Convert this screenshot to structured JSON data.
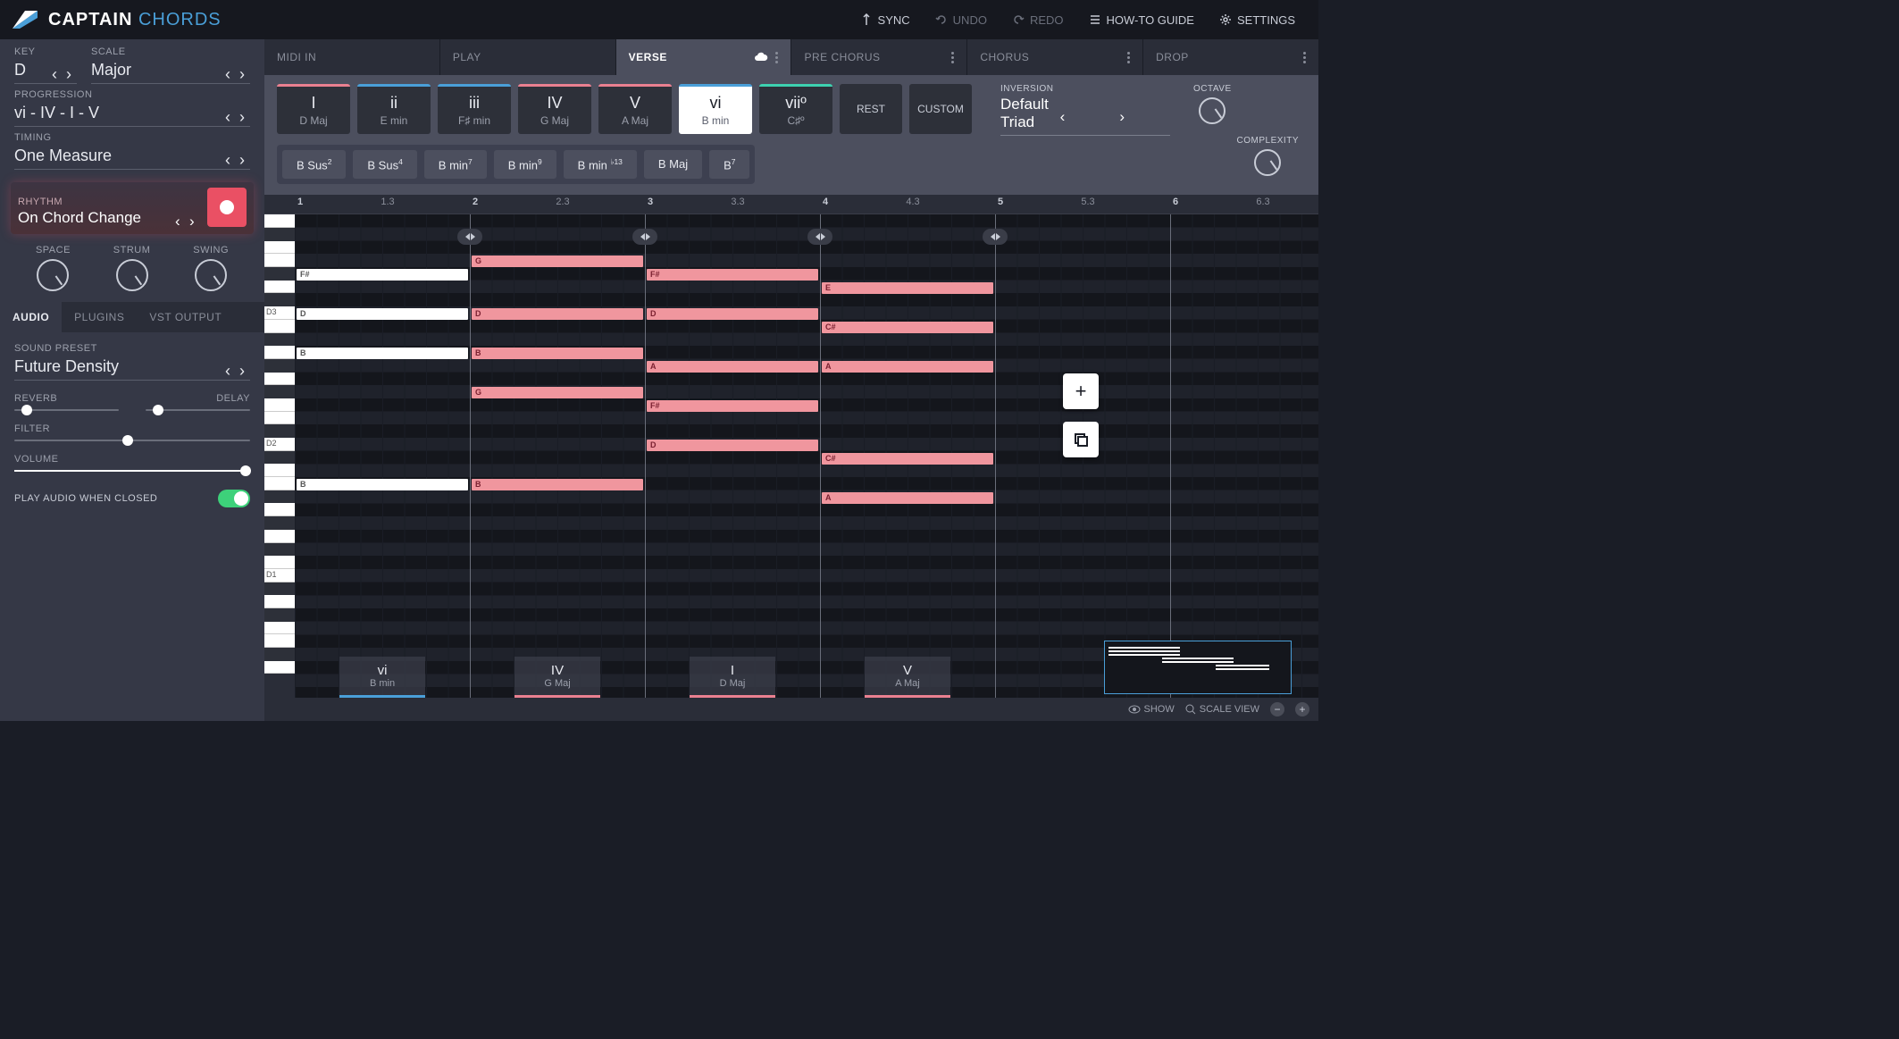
{
  "app": {
    "name1": "CAPTAIN",
    "name2": "CHORDS"
  },
  "header": {
    "sync": "SYNC",
    "undo": "UNDO",
    "redo": "REDO",
    "guide": "HOW-TO GUIDE",
    "settings": "SETTINGS"
  },
  "sidebar": {
    "key_label": "KEY",
    "key_value": "D",
    "scale_label": "SCALE",
    "scale_value": "Major",
    "progression_label": "PROGRESSION",
    "progression_value": "vi - IV - I - V",
    "timing_label": "TIMING",
    "timing_value": "One Measure",
    "rhythm_label": "RHYTHM",
    "rhythm_value": "On Chord Change",
    "knobs": {
      "space": "SPACE",
      "strum": "STRUM",
      "swing": "SWING"
    },
    "audio_tabs": {
      "audio": "AUDIO",
      "plugins": "PLUGINS",
      "vst": "VST OUTPUT"
    },
    "preset_label": "SOUND PRESET",
    "preset_value": "Future Density",
    "reverb": "REVERB",
    "delay": "DELAY",
    "filter": "FILTER",
    "volume": "VOLUME",
    "play_closed": "PLAY AUDIO WHEN CLOSED"
  },
  "section_tabs": {
    "midi_in": "MIDI IN",
    "play": "PLAY",
    "verse": "VERSE",
    "pre_chorus": "PRE CHORUS",
    "chorus": "CHORUS",
    "drop": "DROP"
  },
  "chords": [
    {
      "roman": "I",
      "name": "D Maj",
      "color": "pink"
    },
    {
      "roman": "ii",
      "name": "E min",
      "color": "blue"
    },
    {
      "roman": "iii",
      "name": "F♯ min",
      "color": "blue"
    },
    {
      "roman": "IV",
      "name": "G Maj",
      "color": "pink"
    },
    {
      "roman": "V",
      "name": "A Maj",
      "color": "pink"
    },
    {
      "roman": "vi",
      "name": "B min",
      "color": "blue",
      "selected": true
    },
    {
      "roman": "viiº",
      "name": "C♯º",
      "color": "teal"
    }
  ],
  "util": {
    "rest": "REST",
    "custom": "CUSTOM"
  },
  "inversion": {
    "label": "INVERSION",
    "value": "Default Triad"
  },
  "octave_label": "OCTAVE",
  "complexity_label": "COMPLEXITY",
  "variants": [
    "B Sus²",
    "B Sus⁴",
    "B min⁷",
    "B min⁹",
    "B min ♭13",
    "B Maj",
    "B⁷"
  ],
  "ruler": [
    "1",
    "1.3",
    "2",
    "2.3",
    "3",
    "3.3",
    "4",
    "4.3",
    "5",
    "5.3",
    "6",
    "6.3"
  ],
  "key_labels": {
    "d3": "D3",
    "d2": "D2",
    "d1": "D1"
  },
  "progression_chords": [
    {
      "roman": "vi",
      "name": "B min",
      "color": "#4a9fd8"
    },
    {
      "roman": "IV",
      "name": "G Maj",
      "color": "#ea8090"
    },
    {
      "roman": "I",
      "name": "D Maj",
      "color": "#ea8090"
    },
    {
      "roman": "V",
      "name": "A Maj",
      "color": "#ea8090"
    }
  ],
  "notes_block1": [
    "F#",
    "D",
    "B",
    "B"
  ],
  "notes_block2": [
    "G",
    "D",
    "B",
    "G",
    "B"
  ],
  "notes_block3": [
    "F#",
    "D",
    "A",
    "F#",
    "D"
  ],
  "notes_block4": [
    "E",
    "C#",
    "A",
    "C#",
    "A"
  ],
  "bottom": {
    "show": "SHOW",
    "scale_view": "SCALE VIEW"
  }
}
